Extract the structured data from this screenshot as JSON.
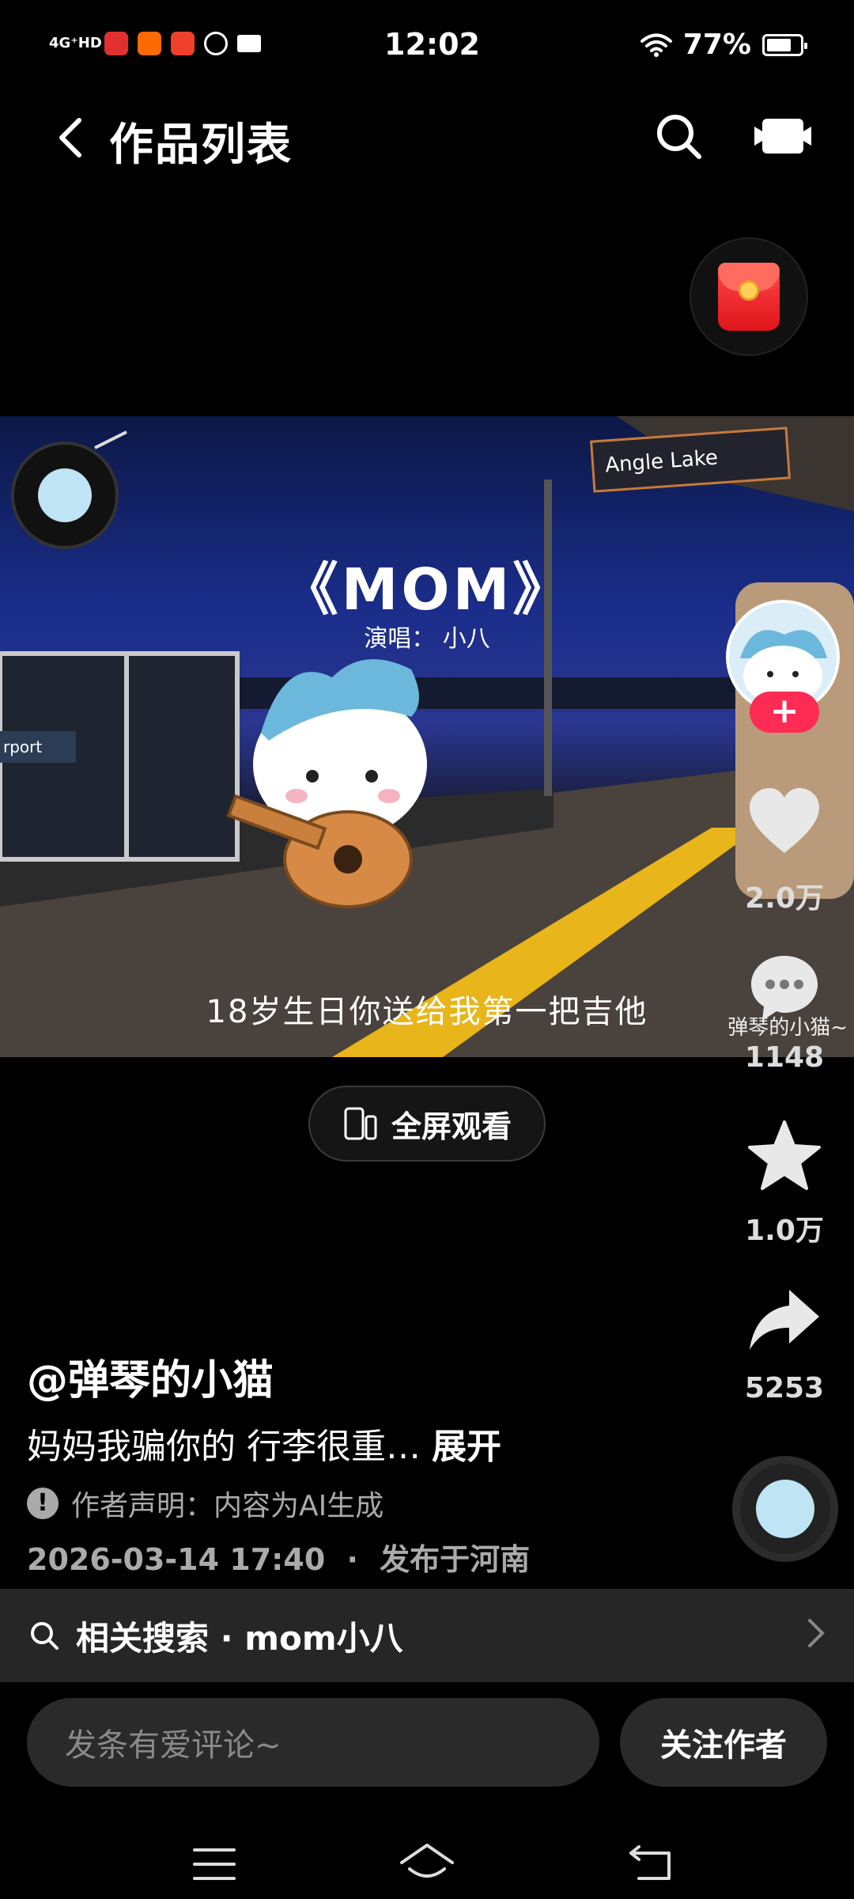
{
  "status_bar": {
    "network": "4G⁺HD",
    "time": "12:02",
    "battery": "77%",
    "battery_level": 0.77
  },
  "header": {
    "title": "作品列表",
    "icons": [
      "back-icon",
      "search-icon",
      "camera-icon"
    ]
  },
  "video": {
    "sign_text": "Angle Lake",
    "song_title": "《MOM》",
    "singer": "演唱：  小八",
    "lyric": "18岁生日你送给我第一把吉他",
    "watermark": "弹琴的小猫~"
  },
  "rail": {
    "likes": "2.0万",
    "comments": "1148",
    "favorites": "1.0万",
    "shares": "5253"
  },
  "fullscreen": {
    "label": "全屏观看"
  },
  "post": {
    "author": "@弹琴的小猫",
    "description": "妈妈我骗你的 行李很重…",
    "expand": "展开",
    "declaration": "作者声明：内容为AI生成",
    "datetime": "2026-03-14 17:40",
    "separator": "·",
    "location": "发布于河南"
  },
  "related": {
    "label": "相关搜索 · mom小八"
  },
  "bottom": {
    "comment_placeholder": "发条有爱评论~",
    "follow_label": "关注作者"
  },
  "colors": {
    "accent": "#fe2c55",
    "background": "#000000"
  }
}
